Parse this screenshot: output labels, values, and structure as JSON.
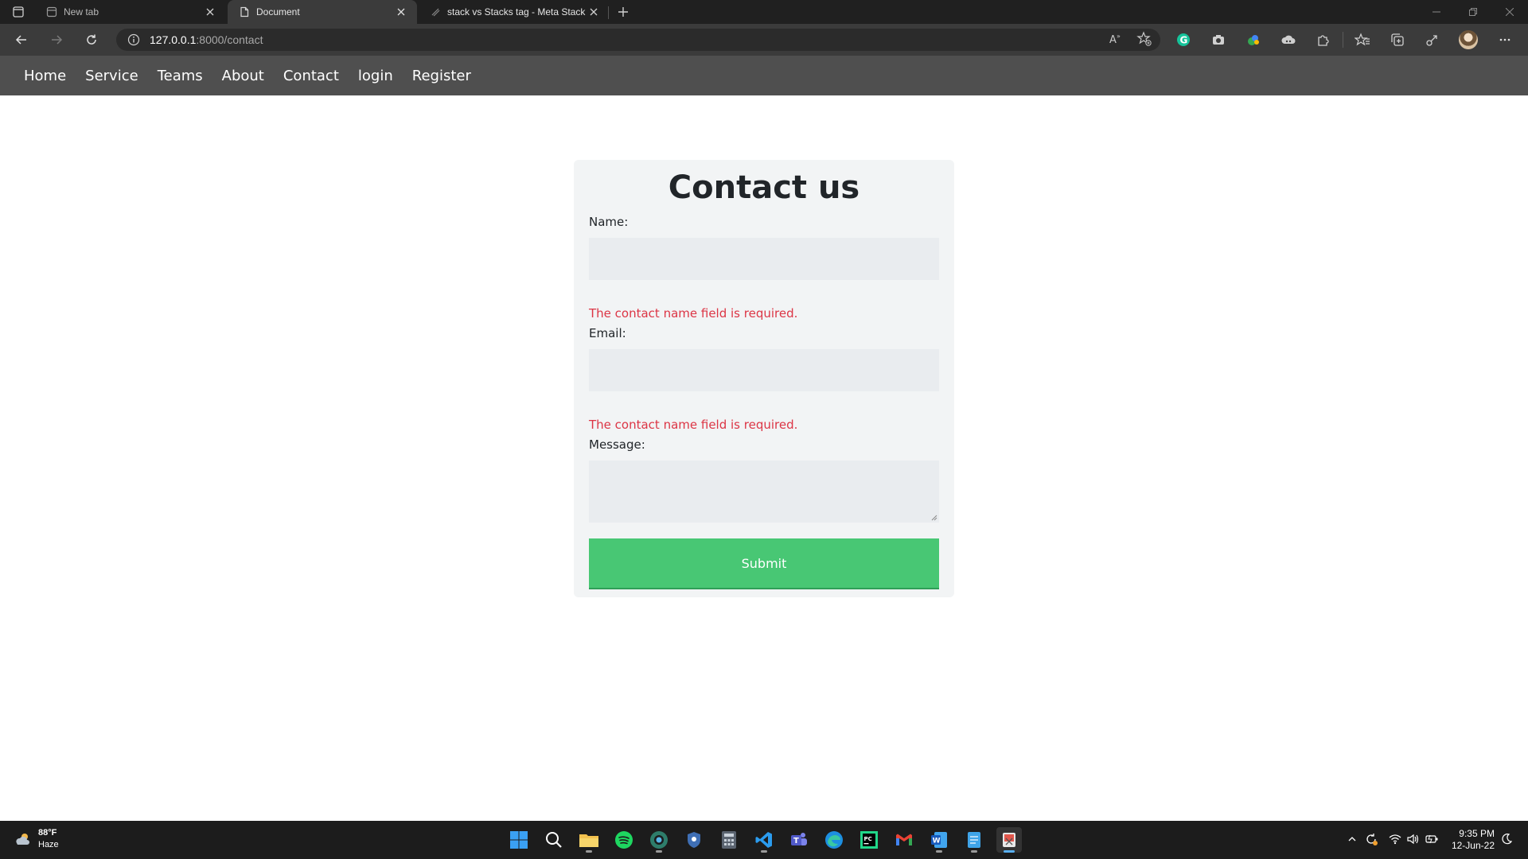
{
  "browser": {
    "tabs": [
      {
        "title": "New tab",
        "icon": "newtab-icon",
        "active": false
      },
      {
        "title": "Document",
        "icon": "document-icon",
        "active": true
      },
      {
        "title": "stack vs Stacks tag - Meta Stack Exchange",
        "icon": "stackexchange-icon",
        "active": false
      }
    ],
    "address": {
      "host": "127.0.0.1",
      "rest": ":8000/contact"
    },
    "extensions": [
      "grammarly-icon",
      "camera-icon",
      "colorful-extension-icon",
      "cloud-extension-icon",
      "puzzle-icon",
      "favorites-icon",
      "collections-icon",
      "share-icon",
      "profile-avatar",
      "more-icon"
    ]
  },
  "site_nav": {
    "items": [
      "Home",
      "Service",
      "Teams",
      "About",
      "Contact",
      "login",
      "Register"
    ]
  },
  "contact": {
    "heading": "Contact us",
    "name_label": "Name:",
    "name_value": "",
    "name_error": "The contact name field is required.",
    "email_label": "Email:",
    "email_value": "",
    "email_error": "The contact name field is required.",
    "message_label": "Message:",
    "message_value": "",
    "submit_label": "Submit",
    "error_color": "#dc3545",
    "submit_color": "#48c774"
  },
  "taskbar": {
    "weather": {
      "temp": "88°F",
      "condition": "Haze"
    },
    "apps": [
      "start-icon",
      "search-icon",
      "file-explorer-icon",
      "spotify-icon",
      "edge-dev-icon",
      "security-icon",
      "calculator-icon",
      "vscode-icon",
      "teams-icon",
      "edge-icon",
      "pycharm-icon",
      "gmail-icon",
      "word-icon",
      "notepad-icon",
      "snipping-tool-icon"
    ],
    "clock": {
      "time": "9:35 PM",
      "date": "12-Jun-22"
    }
  }
}
